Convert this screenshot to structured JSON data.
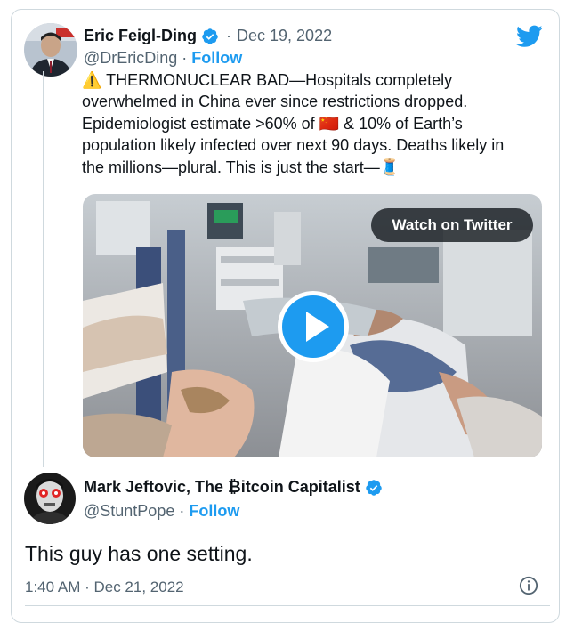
{
  "original_tweet": {
    "author_name": "Eric Feigl-Ding",
    "date": "Dec 19, 2022",
    "handle": "@DrEricDing",
    "follow_label": "Follow",
    "text_lines": [
      "⚠️ THERMONUCLEAR BAD—Hospitals completely",
      "overwhelmed in China ever since restrictions dropped.",
      "Epidemiologist estimate >60% of 🇨🇳 & 10% of Earth’s",
      "population likely infected over next 90 days. Deaths likely in",
      "the millions—plural. This is just the start—🧵"
    ],
    "media_button_label": "Watch on Twitter"
  },
  "reply_tweet": {
    "author_name": "Mark Jeftovic, The ₿itcoin Capitalist",
    "handle": "@StuntPope",
    "follow_label": "Follow",
    "text": "This guy has one setting.",
    "timestamp": "1:40 AM · Dec 21, 2022"
  },
  "separator": "·",
  "colors": {
    "accent": "#1d9bf0",
    "text": "#0f1419",
    "muted": "#536471",
    "border": "#cfd9de"
  },
  "icons": [
    "twitter-bird-icon",
    "verified-badge-icon",
    "play-icon",
    "info-icon"
  ]
}
